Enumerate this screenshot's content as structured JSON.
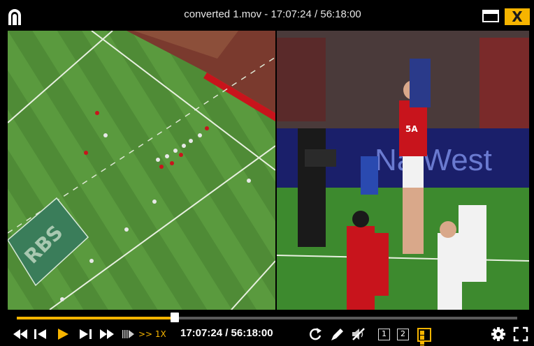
{
  "window": {
    "title": "converted 1.mov - 17:07:24 / 56:18:00",
    "close_label": "X"
  },
  "video": {
    "left_banner": "RBS",
    "right_banner": "NatWest",
    "shirt_number": "5A"
  },
  "player": {
    "progress": 0.316,
    "speed": ">> 1X",
    "time": "17:07:24 / 56:18:00",
    "view1_label": "1",
    "view2_label": "2"
  },
  "colors": {
    "accent": "#f6b400",
    "pitch": "#4f8b36",
    "wales_red": "#c8141c"
  },
  "icons": {
    "logo": "app-logo-icon",
    "maximize": "maximize-icon",
    "close": "close-icon",
    "rewind": "rewind-icon",
    "step_back": "step-back-icon",
    "play": "play-icon",
    "step_forward": "step-forward-icon",
    "fast_forward": "fast-forward-icon",
    "slow": "slow-motion-icon",
    "loop": "loop-icon",
    "draw": "draw-pen-icon",
    "mute": "mute-icon",
    "grid": "grid-view-icon",
    "settings": "gear-icon",
    "fullscreen": "fullscreen-icon"
  }
}
